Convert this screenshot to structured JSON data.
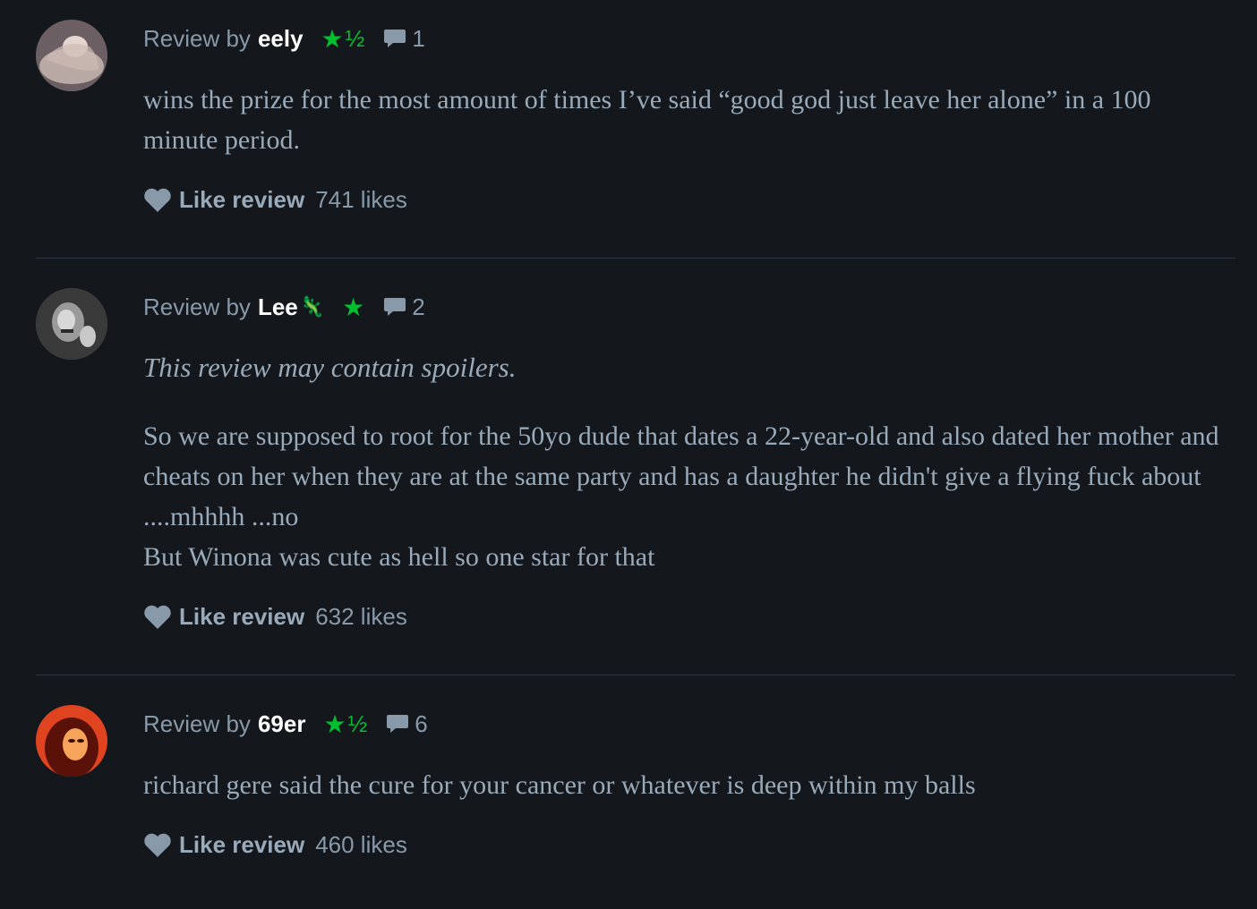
{
  "reviews": [
    {
      "byline": "Review by",
      "author": "eely",
      "author_emoji": "",
      "rating": {
        "stars": 1.5,
        "star_glyph": "★",
        "half_glyph": "½"
      },
      "comment_count": "1",
      "spoiler_notice": "",
      "body": "wins the prize for the most amount of times I’ve said “good god just leave her alone” in a 100 minute period.",
      "like_label": "Like review",
      "likes": "741 likes",
      "avatar_colors": [
        "#b9a9a4",
        "#6b5f63",
        "#e4d6cf"
      ]
    },
    {
      "byline": "Review by",
      "author": "Lee",
      "author_emoji": "🦎",
      "rating": {
        "stars": 1,
        "star_glyph": "★",
        "half_glyph": ""
      },
      "comment_count": "2",
      "spoiler_notice": "This review may contain spoilers.",
      "body_lines": [
        "So we are supposed to root for the 50yo dude that dates a 22-year-old and also dated her mother and cheats on her when they are at the same party and has a daughter he didn't give a flying fuck about ....mhhhh ...no",
        "But Winona was cute as hell so one star for that"
      ],
      "like_label": "Like review",
      "likes": "632 likes",
      "avatar_colors": [
        "#9a9a9a",
        "#3a3a3a",
        "#d8d8d8"
      ]
    },
    {
      "byline": "Review by",
      "author": "69er",
      "author_emoji": "",
      "rating": {
        "stars": 1.5,
        "star_glyph": "★",
        "half_glyph": "½"
      },
      "comment_count": "6",
      "spoiler_notice": "",
      "body": "richard gere said the cure for your cancer or whatever is deep within my balls",
      "like_label": "Like review",
      "likes": "460 likes",
      "avatar_colors": [
        "#e0431f",
        "#5a1208",
        "#f6a45a"
      ]
    }
  ],
  "colors": {
    "background": "#14181c",
    "star_green": "#00c030",
    "muted_text": "#8899aa",
    "body_text": "#99aabb",
    "author_text": "#ffffff"
  },
  "icons": {
    "rating": "star-icon",
    "comments": "speech-bubble-icon",
    "like": "heart-icon"
  }
}
